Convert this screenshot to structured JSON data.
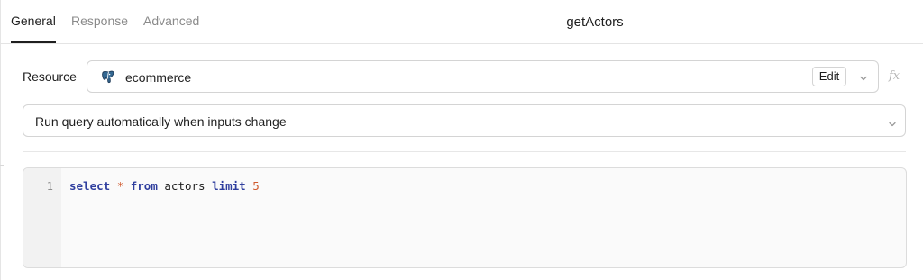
{
  "tabs": [
    {
      "label": "General",
      "active": true
    },
    {
      "label": "Response",
      "active": false
    },
    {
      "label": "Advanced",
      "active": false
    }
  ],
  "query_name": "getActors",
  "resource": {
    "label": "Resource",
    "value": "ecommerce",
    "icon": "postgres-elephant-icon",
    "edit_label": "Edit",
    "fx_label": "fx"
  },
  "trigger": {
    "value": "Run query automatically when inputs change"
  },
  "editor": {
    "line_numbers": [
      "1"
    ],
    "tokens": {
      "kw_select": "select",
      "op_star": "*",
      "kw_from": "from",
      "ident_table": "actors",
      "kw_limit": "limit",
      "num_limit": "5"
    }
  },
  "colors": {
    "keyword": "#2f3e9e",
    "operator_number": "#d05a2e",
    "active_tab": "#1f1f1f",
    "inactive_tab": "#8a8a8a",
    "postgres_blue": "#336791"
  }
}
